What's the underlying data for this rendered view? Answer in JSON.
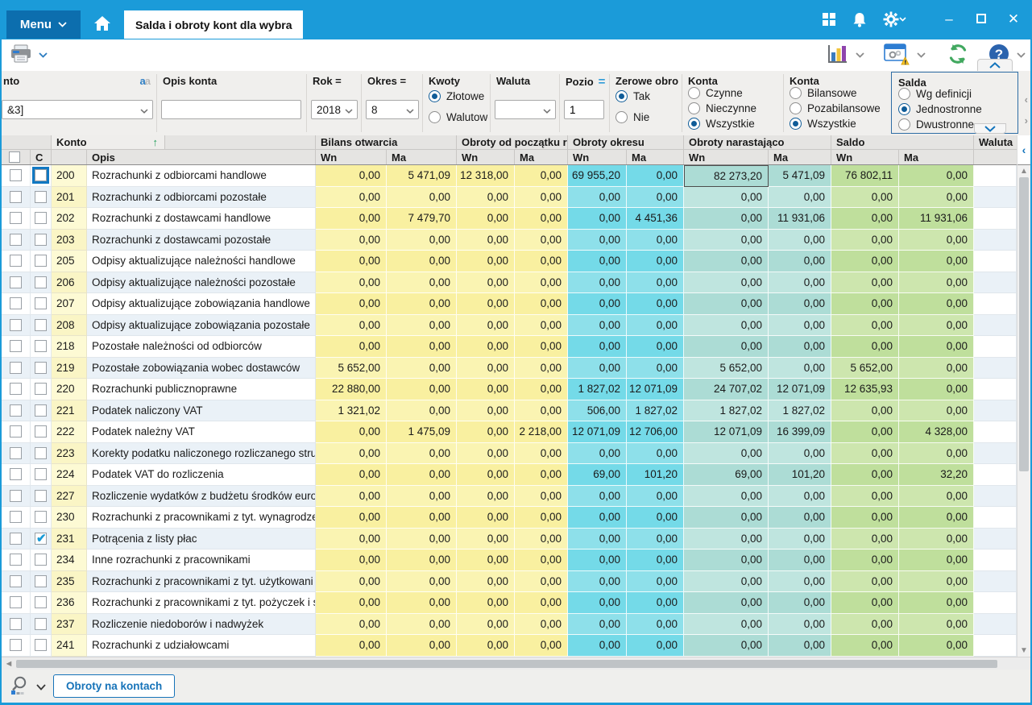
{
  "window": {
    "menu_label": "Menu",
    "tab_title": "Salda i obroty kont dla wybra"
  },
  "filters": {
    "konto": {
      "label": "nto",
      "value": "&3]"
    },
    "opis": {
      "label": "Opis konta",
      "value": ""
    },
    "rok": {
      "label": "Rok =",
      "value": "2018"
    },
    "okres": {
      "label": "Okres =",
      "value": "8"
    },
    "kwoty": {
      "label": "Kwoty",
      "options": [
        "Złotowe",
        "Walutowe"
      ],
      "selected": "Złotowe"
    },
    "waluta": {
      "label": "Waluta",
      "value": ""
    },
    "poziom": {
      "label": "Pozio",
      "value": "1"
    },
    "zerowe": {
      "label": "Zerowe obro",
      "options": [
        "Tak",
        "Nie"
      ],
      "selected": "Tak"
    },
    "konta1": {
      "label": "Konta",
      "options": [
        "Czynne",
        "Nieczynne",
        "Wszystkie"
      ],
      "selected": "Wszystkie"
    },
    "konta2": {
      "label": "Konta",
      "options": [
        "Bilansowe",
        "Pozabilansowe",
        "Wszystkie"
      ],
      "selected": "Wszystkie"
    },
    "salda": {
      "label": "Salda",
      "options": [
        "Wg definicji",
        "Jednostronne",
        "Dwustronne"
      ],
      "selected": "Jednostronne"
    }
  },
  "table": {
    "groups": {
      "konto": "Konto",
      "bilans_otwarcia": "Bilans otwarcia",
      "obroty_poczatku": "Obroty od początku r",
      "obroty_okresu": "Obroty okresu",
      "obroty_narastajaco": "Obroty narastająco",
      "saldo": "Saldo",
      "waluta": "Waluta"
    },
    "sub": {
      "c": "C",
      "opis": "Opis",
      "wn": "Wn",
      "ma": "Ma"
    },
    "rows": [
      {
        "konto": "200",
        "opis": "Rozrachunki z odbiorcami handlowe",
        "checked": false,
        "values": [
          "0,00",
          "5 471,09",
          "12 318,00",
          "0,00",
          "69 955,20",
          "0,00",
          "82 273,20",
          "5 471,09",
          "76 802,11",
          "0,00"
        ]
      },
      {
        "konto": "201",
        "opis": "Rozrachunki z odbiorcami pozostałe",
        "checked": false,
        "values": [
          "0,00",
          "0,00",
          "0,00",
          "0,00",
          "0,00",
          "0,00",
          "0,00",
          "0,00",
          "0,00",
          "0,00"
        ]
      },
      {
        "konto": "202",
        "opis": "Rozrachunki z dostawcami handlowe",
        "checked": false,
        "values": [
          "0,00",
          "7 479,70",
          "0,00",
          "0,00",
          "0,00",
          "4 451,36",
          "0,00",
          "11 931,06",
          "0,00",
          "11 931,06"
        ]
      },
      {
        "konto": "203",
        "opis": "Rozrachunki z dostawcami pozostałe",
        "checked": false,
        "values": [
          "0,00",
          "0,00",
          "0,00",
          "0,00",
          "0,00",
          "0,00",
          "0,00",
          "0,00",
          "0,00",
          "0,00"
        ]
      },
      {
        "konto": "205",
        "opis": "Odpisy aktualizujące należności handlowe",
        "checked": false,
        "values": [
          "0,00",
          "0,00",
          "0,00",
          "0,00",
          "0,00",
          "0,00",
          "0,00",
          "0,00",
          "0,00",
          "0,00"
        ]
      },
      {
        "konto": "206",
        "opis": "Odpisy aktualizujące należności pozostałe",
        "checked": false,
        "values": [
          "0,00",
          "0,00",
          "0,00",
          "0,00",
          "0,00",
          "0,00",
          "0,00",
          "0,00",
          "0,00",
          "0,00"
        ]
      },
      {
        "konto": "207",
        "opis": "Odpisy aktualizujące zobowiązania handlowe",
        "checked": false,
        "values": [
          "0,00",
          "0,00",
          "0,00",
          "0,00",
          "0,00",
          "0,00",
          "0,00",
          "0,00",
          "0,00",
          "0,00"
        ]
      },
      {
        "konto": "208",
        "opis": "Odpisy aktualizujące zobowiązania pozostałe",
        "checked": false,
        "values": [
          "0,00",
          "0,00",
          "0,00",
          "0,00",
          "0,00",
          "0,00",
          "0,00",
          "0,00",
          "0,00",
          "0,00"
        ]
      },
      {
        "konto": "218",
        "opis": "Pozostałe należności od odbiorców",
        "checked": false,
        "values": [
          "0,00",
          "0,00",
          "0,00",
          "0,00",
          "0,00",
          "0,00",
          "0,00",
          "0,00",
          "0,00",
          "0,00"
        ]
      },
      {
        "konto": "219",
        "opis": "Pozostałe zobowiązania wobec dostawców",
        "checked": false,
        "values": [
          "5 652,00",
          "0,00",
          "0,00",
          "0,00",
          "0,00",
          "0,00",
          "5 652,00",
          "0,00",
          "5 652,00",
          "0,00"
        ]
      },
      {
        "konto": "220",
        "opis": "Rozrachunki publicznoprawne",
        "checked": false,
        "values": [
          "22 880,00",
          "0,00",
          "0,00",
          "0,00",
          "1 827,02",
          "12 071,09",
          "24 707,02",
          "12 071,09",
          "12 635,93",
          "0,00"
        ]
      },
      {
        "konto": "221",
        "opis": "Podatek naliczony VAT",
        "checked": false,
        "values": [
          "1 321,02",
          "0,00",
          "0,00",
          "0,00",
          "506,00",
          "1 827,02",
          "1 827,02",
          "1 827,02",
          "0,00",
          "0,00"
        ]
      },
      {
        "konto": "222",
        "opis": "Podatek należny VAT",
        "checked": false,
        "values": [
          "0,00",
          "1 475,09",
          "0,00",
          "2 218,00",
          "12 071,09",
          "12 706,00",
          "12 071,09",
          "16 399,09",
          "0,00",
          "4 328,00"
        ]
      },
      {
        "konto": "223",
        "opis": "Korekty podatku naliczonego rozliczanego stru",
        "checked": false,
        "values": [
          "0,00",
          "0,00",
          "0,00",
          "0,00",
          "0,00",
          "0,00",
          "0,00",
          "0,00",
          "0,00",
          "0,00"
        ]
      },
      {
        "konto": "224",
        "opis": "Podatek VAT do rozliczenia",
        "checked": false,
        "values": [
          "0,00",
          "0,00",
          "0,00",
          "0,00",
          "69,00",
          "101,20",
          "69,00",
          "101,20",
          "0,00",
          "32,20"
        ]
      },
      {
        "konto": "227",
        "opis": "Rozliczenie wydatków z budżetu środków euro",
        "checked": false,
        "values": [
          "0,00",
          "0,00",
          "0,00",
          "0,00",
          "0,00",
          "0,00",
          "0,00",
          "0,00",
          "0,00",
          "0,00"
        ]
      },
      {
        "konto": "230",
        "opis": "Rozrachunki z pracownikami z tyt. wynagrodze",
        "checked": false,
        "values": [
          "0,00",
          "0,00",
          "0,00",
          "0,00",
          "0,00",
          "0,00",
          "0,00",
          "0,00",
          "0,00",
          "0,00"
        ]
      },
      {
        "konto": "231",
        "opis": "Potrącenia z listy płac",
        "checked": true,
        "values": [
          "0,00",
          "0,00",
          "0,00",
          "0,00",
          "0,00",
          "0,00",
          "0,00",
          "0,00",
          "0,00",
          "0,00"
        ]
      },
      {
        "konto": "234",
        "opis": "Inne rozrachunki z pracownikami",
        "checked": false,
        "values": [
          "0,00",
          "0,00",
          "0,00",
          "0,00",
          "0,00",
          "0,00",
          "0,00",
          "0,00",
          "0,00",
          "0,00"
        ]
      },
      {
        "konto": "235",
        "opis": "Rozrachunki z pracownikami z tyt. użytkowani",
        "checked": false,
        "values": [
          "0,00",
          "0,00",
          "0,00",
          "0,00",
          "0,00",
          "0,00",
          "0,00",
          "0,00",
          "0,00",
          "0,00"
        ]
      },
      {
        "konto": "236",
        "opis": "Rozrachunki z pracownikami z tyt. pożyczek i s",
        "checked": false,
        "values": [
          "0,00",
          "0,00",
          "0,00",
          "0,00",
          "0,00",
          "0,00",
          "0,00",
          "0,00",
          "0,00",
          "0,00"
        ]
      },
      {
        "konto": "237",
        "opis": "Rozliczenie niedoborów i nadwyżek",
        "checked": false,
        "values": [
          "0,00",
          "0,00",
          "0,00",
          "0,00",
          "0,00",
          "0,00",
          "0,00",
          "0,00",
          "0,00",
          "0,00"
        ]
      },
      {
        "konto": "241",
        "opis": "Rozrachunki z udziałowcami",
        "checked": false,
        "values": [
          "0,00",
          "0,00",
          "0,00",
          "0,00",
          "0,00",
          "0,00",
          "0,00",
          "0,00",
          "0,00",
          "0,00"
        ]
      }
    ]
  },
  "footer": {
    "tab_label": "Obroty na kontach"
  },
  "colors": {
    "accent_blue": "#1b9bd9",
    "dark_blue": "#0c6eae",
    "link_blue": "#1673b9"
  }
}
